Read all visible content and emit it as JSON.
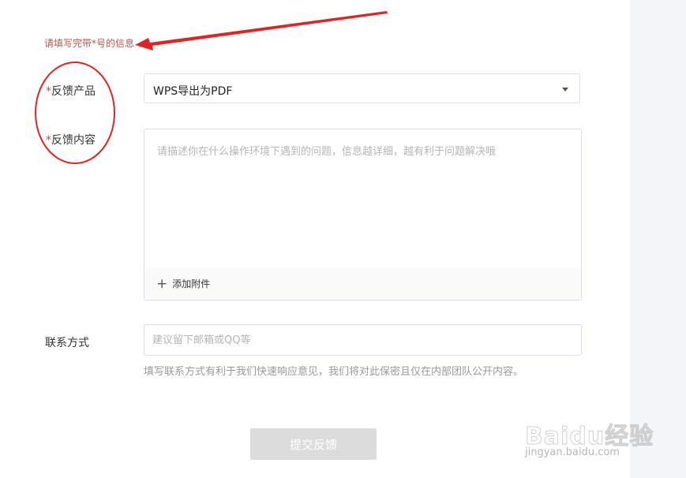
{
  "hint": {
    "text": "请填写完带*号的信息"
  },
  "form": {
    "required_mark": "*",
    "product": {
      "label": "反馈产品",
      "selected": "WPS导出为PDF"
    },
    "content": {
      "label": "反馈内容",
      "placeholder": "请描述你在什么操作环境下遇到的问题，信息越详细，越有利于问题解决哦",
      "attach_icon": "+",
      "attach_label": "添加附件"
    },
    "contact": {
      "label": "联系方式",
      "placeholder": "建议留下邮箱或QQ等",
      "help": "填写联系方式有利于我们快速响应意见，我们将对此保密且仅在内部团队公开内容。"
    },
    "submit_label": "提交反馈"
  },
  "annotations": {
    "color": "#e02424"
  },
  "watermark": {
    "main": "Baidu经验",
    "sub": "jingyan.baidu.com"
  }
}
